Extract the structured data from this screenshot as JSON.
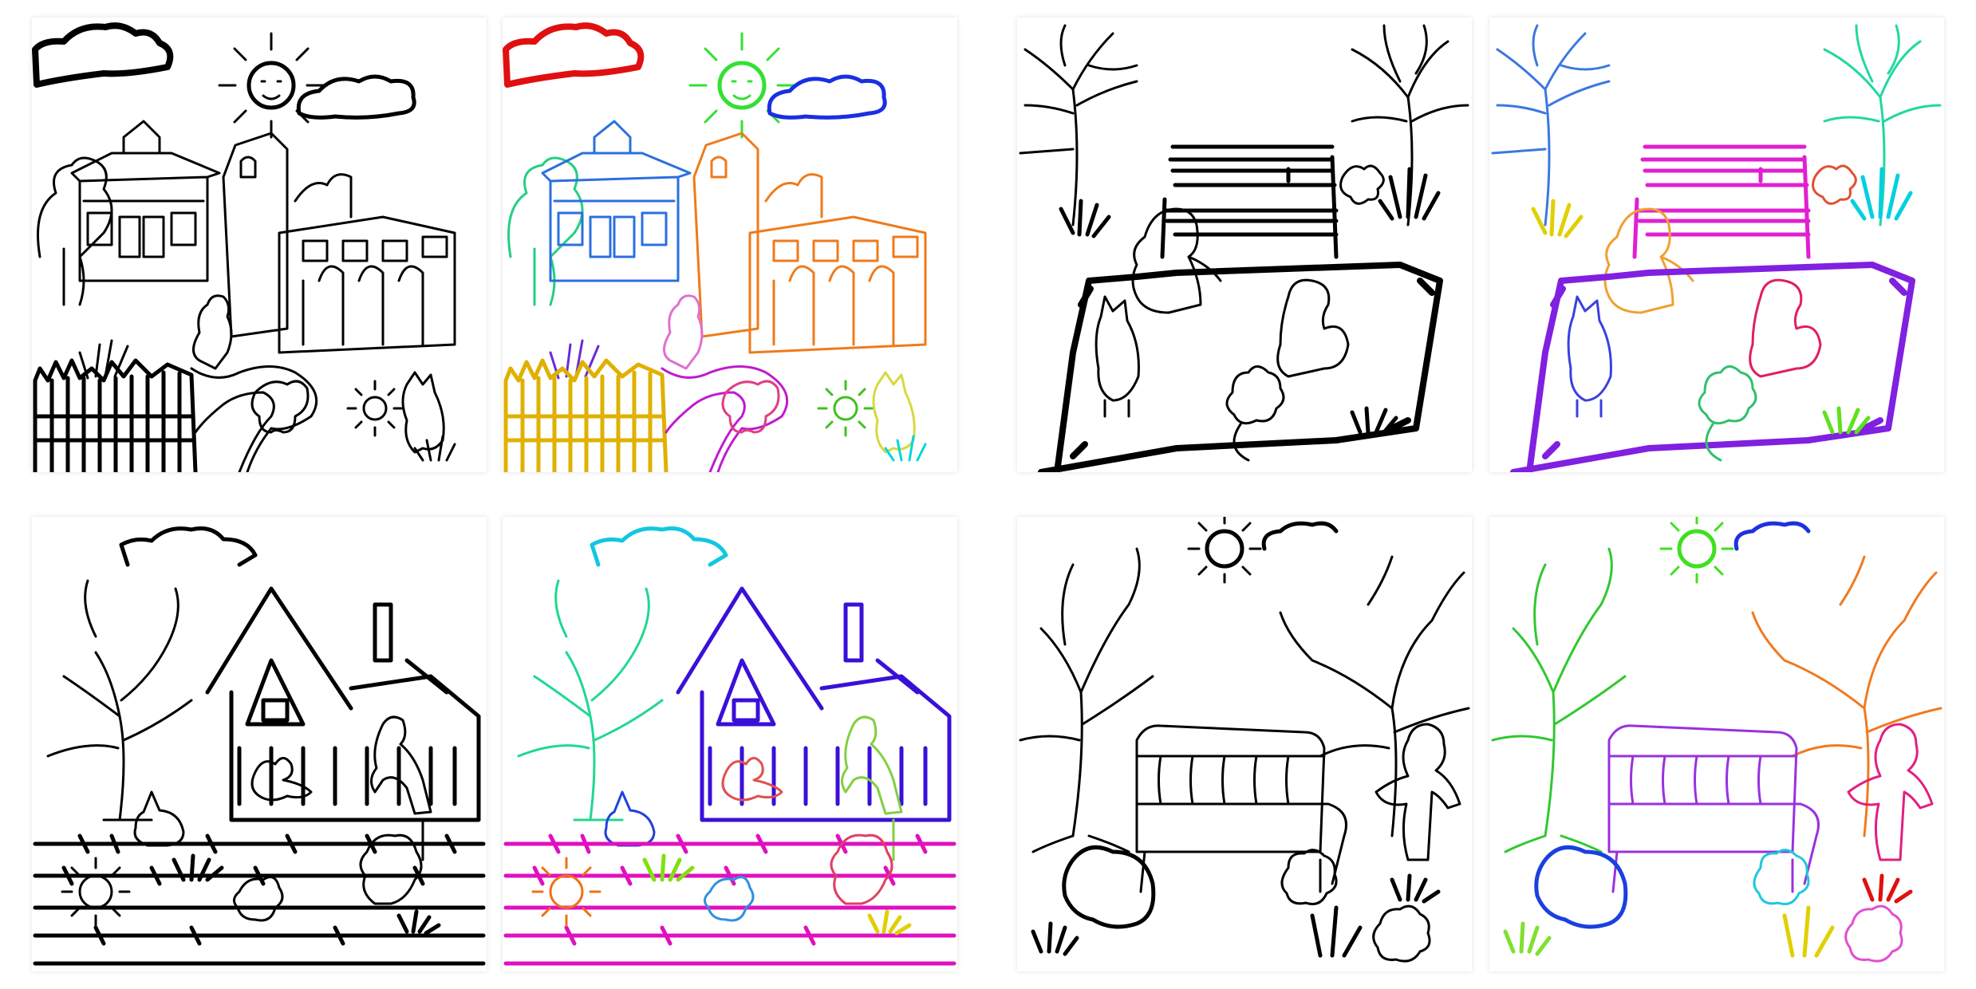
{
  "figure": {
    "description_free": true,
    "columns": [
      "sketch",
      "colored-segmentation"
    ],
    "sketch_color": "#000000"
  },
  "scenes": [
    {
      "id": "scene-village",
      "objects": [
        {
          "name": "cloud-left",
          "color": "#e01010"
        },
        {
          "name": "sun",
          "color": "#33e033"
        },
        {
          "name": "cloud-right",
          "color": "#1a2fe0"
        },
        {
          "name": "tree-bushes",
          "color": "#22d080"
        },
        {
          "name": "house",
          "color": "#2b6fe0"
        },
        {
          "name": "tower-building",
          "color": "#f07a1a"
        },
        {
          "name": "boy",
          "color": "#e070d0"
        },
        {
          "name": "plant",
          "color": "#6a2bd8"
        },
        {
          "name": "fence",
          "color": "#e0b000"
        },
        {
          "name": "path",
          "color": "#c01ad0"
        },
        {
          "name": "dog",
          "color": "#e04080"
        },
        {
          "name": "sunflower",
          "color": "#40c020"
        },
        {
          "name": "cat",
          "color": "#d8d840"
        },
        {
          "name": "grass",
          "color": "#00d8d8"
        }
      ]
    },
    {
      "id": "scene-park-bench-girl",
      "objects": [
        {
          "name": "tree-left",
          "color": "#3a78e0"
        },
        {
          "name": "tree-right",
          "color": "#20d8a0"
        },
        {
          "name": "bench",
          "color": "#e020d0"
        },
        {
          "name": "flower-top",
          "color": "#e05030"
        },
        {
          "name": "grass-right",
          "color": "#00d0e0"
        },
        {
          "name": "grass-left",
          "color": "#e0d000"
        },
        {
          "name": "girl",
          "color": "#f0a030"
        },
        {
          "name": "rug",
          "color": "#8020e0"
        },
        {
          "name": "cat",
          "color": "#3a40e0"
        },
        {
          "name": "dog",
          "color": "#e0205a"
        },
        {
          "name": "flower-bottom",
          "color": "#30c070"
        },
        {
          "name": "grass-bottom",
          "color": "#60e020"
        }
      ]
    },
    {
      "id": "scene-farm-house",
      "objects": [
        {
          "name": "cloud",
          "color": "#10c8e0"
        },
        {
          "name": "tree",
          "color": "#20d890"
        },
        {
          "name": "house",
          "color": "#3a10d8"
        },
        {
          "name": "rabbit",
          "color": "#2040e0"
        },
        {
          "name": "cat",
          "color": "#e05050"
        },
        {
          "name": "man",
          "color": "#80d040"
        },
        {
          "name": "fence-wire",
          "color": "#e010c0"
        },
        {
          "name": "sunflower",
          "color": "#f07010"
        },
        {
          "name": "grass",
          "color": "#80e010"
        },
        {
          "name": "flower",
          "color": "#3090e0"
        },
        {
          "name": "dog",
          "color": "#e04060"
        },
        {
          "name": "grass-small",
          "color": "#e0d000"
        }
      ]
    },
    {
      "id": "scene-bench-trees",
      "objects": [
        {
          "name": "tree-left",
          "color": "#30c830"
        },
        {
          "name": "sun",
          "color": "#40e020"
        },
        {
          "name": "cloud",
          "color": "#2030e0"
        },
        {
          "name": "tree-right",
          "color": "#f07a20"
        },
        {
          "name": "bench",
          "color": "#9a30e0"
        },
        {
          "name": "girl",
          "color": "#e02080"
        },
        {
          "name": "dog",
          "color": "#1a40e0"
        },
        {
          "name": "rose-middle",
          "color": "#20c8e0"
        },
        {
          "name": "grass-left",
          "color": "#80e030"
        },
        {
          "name": "grass-right",
          "color": "#e01010"
        },
        {
          "name": "grass-bottom",
          "color": "#e0d000"
        },
        {
          "name": "rose-bottom",
          "color": "#e050d0"
        }
      ]
    }
  ]
}
